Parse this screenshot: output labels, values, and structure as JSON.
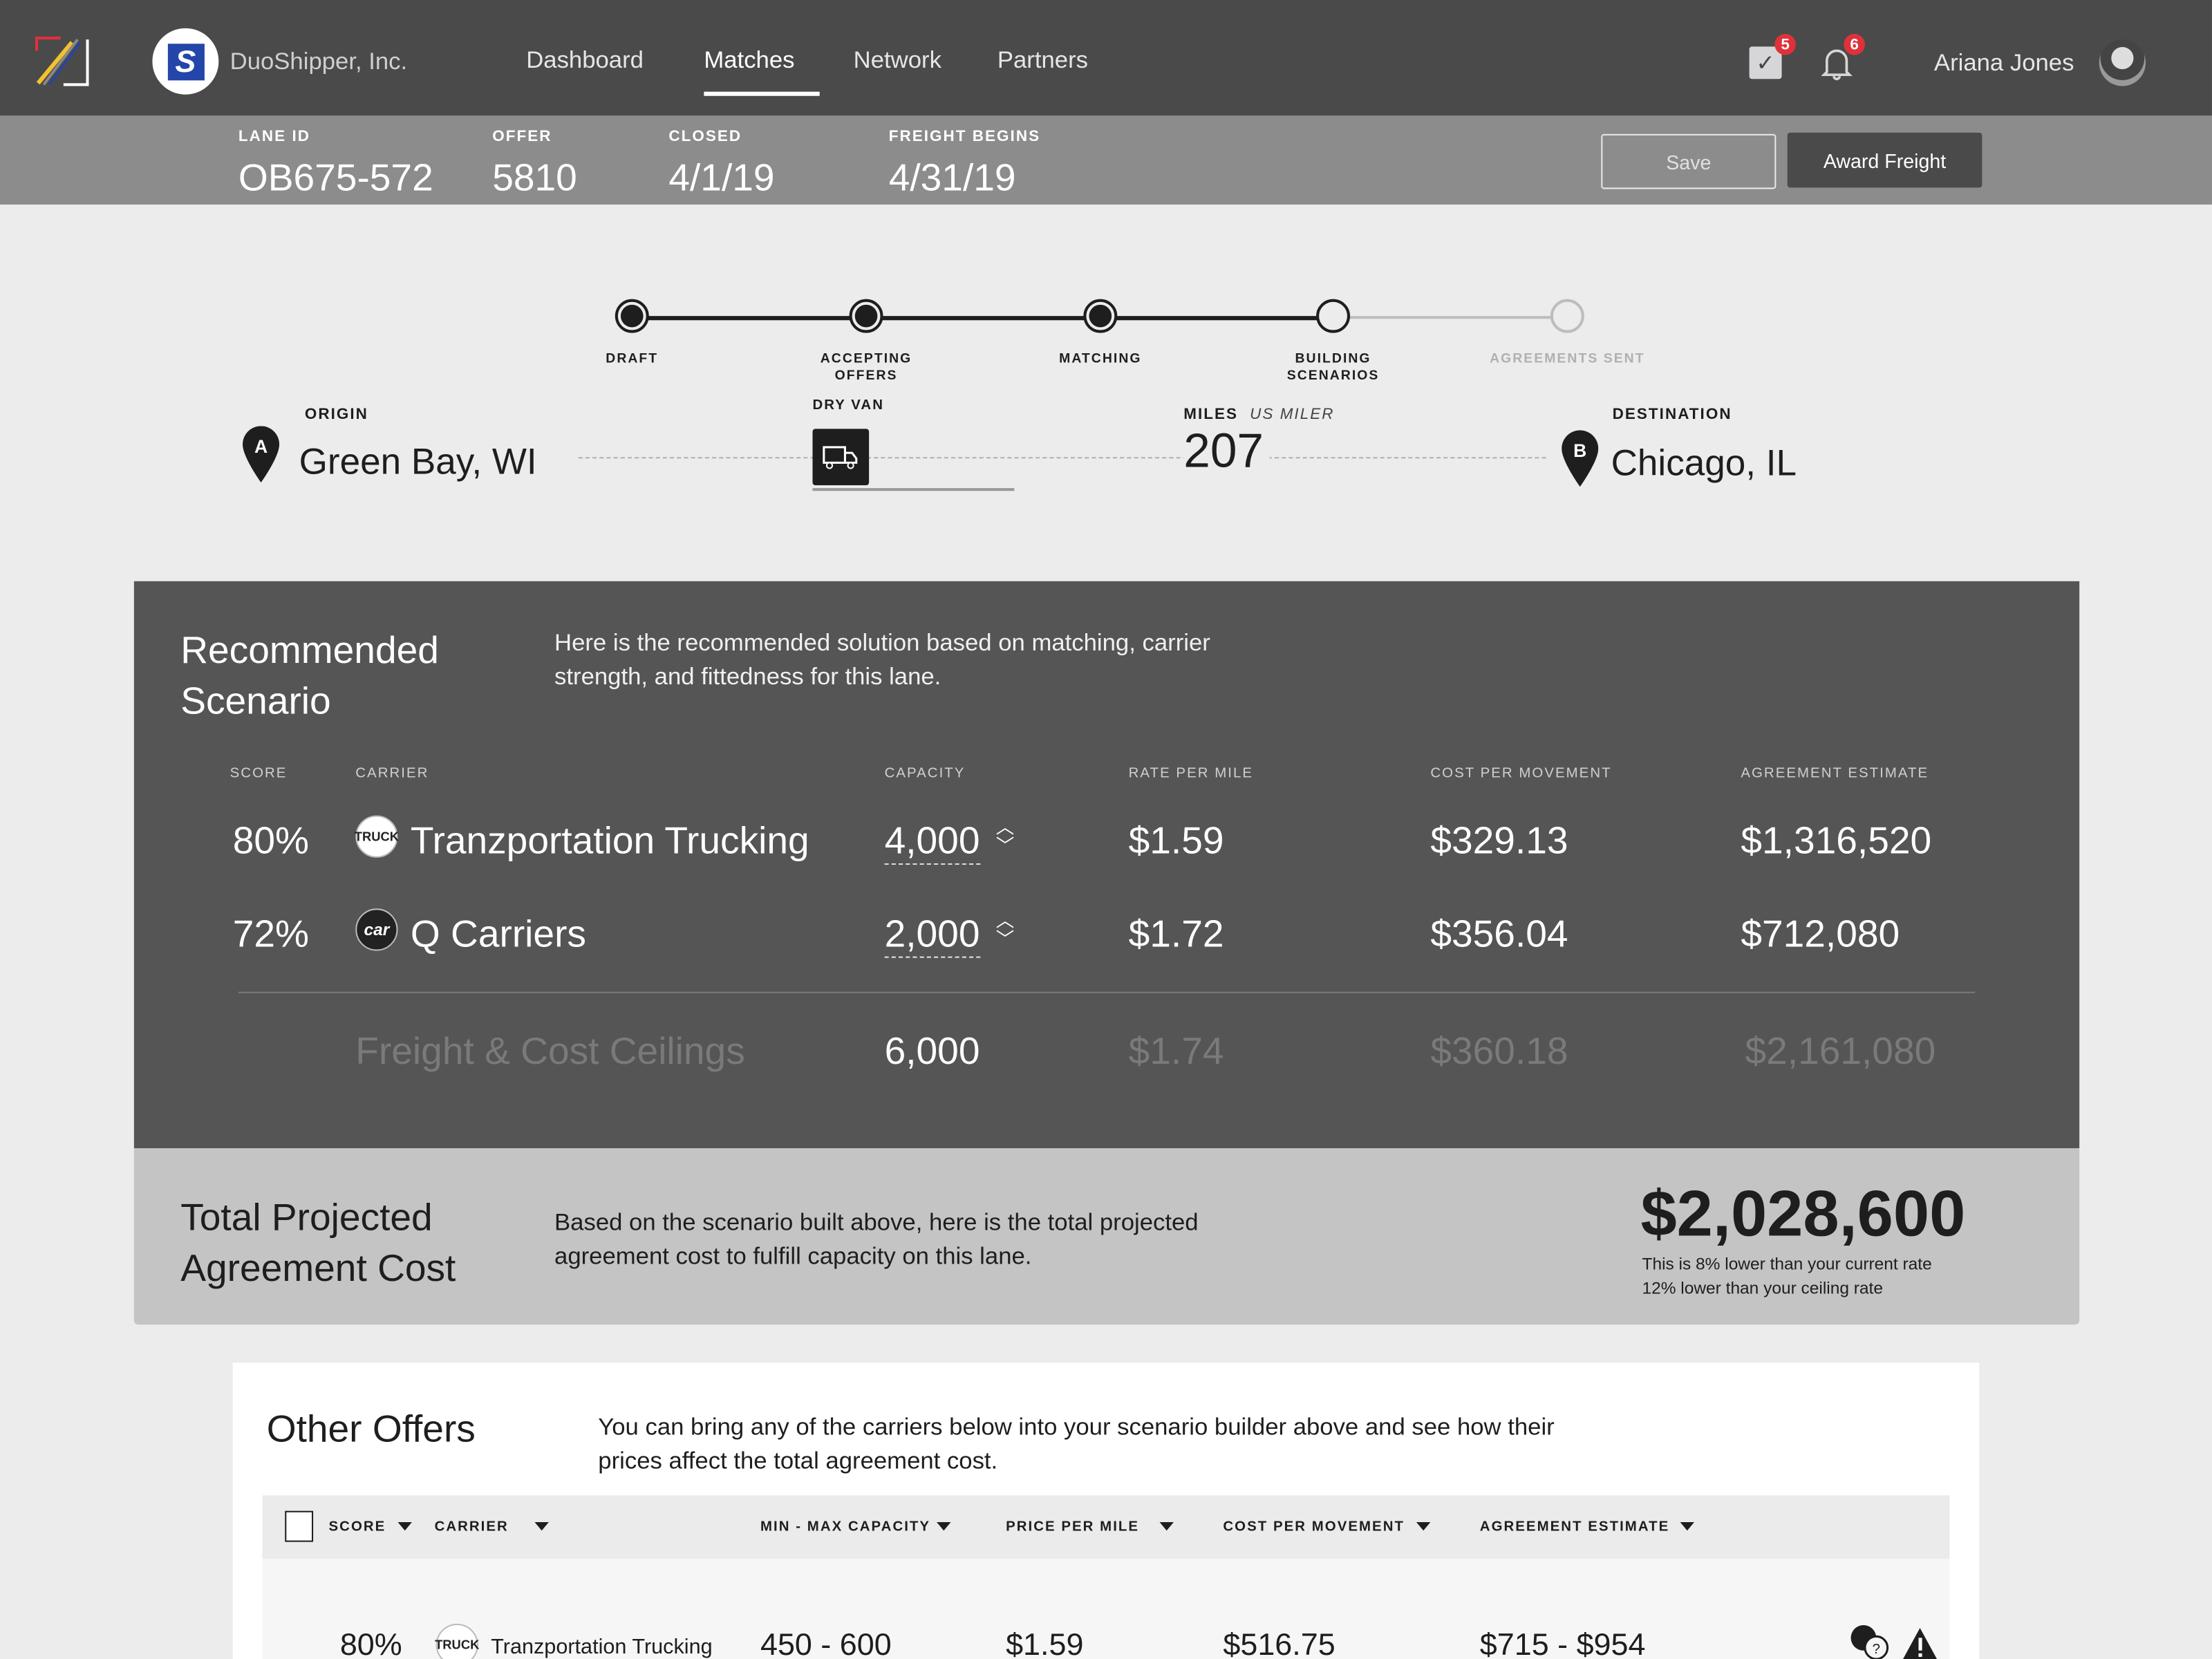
{
  "header": {
    "company": "DuoShipper, Inc.",
    "nav": [
      {
        "label": "Dashboard",
        "active": false
      },
      {
        "label": "Matches",
        "active": true
      },
      {
        "label": "Network",
        "active": false
      },
      {
        "label": "Partners",
        "active": false
      }
    ],
    "tasks_badge": "5",
    "notifications_badge": "6",
    "user_name": "Ariana Jones"
  },
  "lane": {
    "lane_id_label": "LANE ID",
    "lane_id": "OB675-572",
    "offer_label": "OFFER",
    "offer": "5810",
    "closed_label": "CLOSED",
    "closed": "4/1/19",
    "freight_label": "FREIGHT BEGINS",
    "freight_begins": "4/31/19",
    "save": "Save",
    "award": "Award Freight"
  },
  "steps": [
    {
      "label": "DRAFT",
      "state": "done"
    },
    {
      "label": "ACCEPTING OFFERS",
      "state": "done"
    },
    {
      "label": "MATCHING",
      "state": "done"
    },
    {
      "label": "BUILDING SCENARIOS",
      "state": "current"
    },
    {
      "label": "AGREEMENTS SENT",
      "state": "pending"
    }
  ],
  "route": {
    "origin_label": "ORIGIN",
    "origin": "Green Bay, WI",
    "origin_pin": "A",
    "equipment_label": "DRY VAN",
    "miles_label": "MILES",
    "miles_source": "US MILER",
    "miles": "207",
    "destination_label": "DESTINATION",
    "destination": "Chicago, IL",
    "destination_pin": "B"
  },
  "recommended": {
    "title_1": "Recommended",
    "title_2": "Scenario",
    "description": "Here is the recommended solution based on matching, carrier strength, and fittedness for this lane.",
    "columns": [
      "SCORE",
      "CARRIER",
      "CAPACITY",
      "RATE PER MILE",
      "COST PER MOVEMENT",
      "AGREEMENT ESTIMATE"
    ],
    "rows": [
      {
        "score": "80%",
        "carrier": "Tranzportation Trucking",
        "logo": "TRUCK",
        "capacity": "4,000",
        "rate": "$1.59",
        "cost": "$329.13",
        "estimate": "$1,316,520"
      },
      {
        "score": "72%",
        "carrier": "Q Carriers",
        "logo": "car",
        "capacity": "2,000",
        "rate": "$1.72",
        "cost": "$356.04",
        "estimate": "$712,080"
      }
    ],
    "ceiling": {
      "label": "Freight & Cost Ceilings",
      "capacity": "6,000",
      "rate": "$1.74",
      "cost": "$360.18",
      "estimate": "$2,161,080"
    }
  },
  "total": {
    "title_1": "Total Projected",
    "title_2": "Agreement Cost",
    "description": "Based on the scenario built above, here is the total projected agreement cost to fulfill capacity on this lane.",
    "amount": "$2,028,600",
    "note_1": "This is 8% lower than your current rate",
    "note_2": "12% lower than your ceiling rate"
  },
  "other": {
    "title": "Other Offers",
    "description": "You can bring any of the carriers below into your scenario builder above and see how their prices affect the total agreement cost.",
    "columns": [
      "SCORE",
      "CARRIER",
      "MIN - MAX CAPACITY",
      "PRICE PER MILE",
      "COST PER MOVEMENT",
      "AGREEMENT ESTIMATE"
    ],
    "rows": [
      {
        "score": "80%",
        "carrier": "Tranzportation Trucking",
        "logo": "TRUCK",
        "capacity": "450 - 600",
        "rate": "$1.59",
        "cost": "$516.75",
        "estimate": "$715 - $954"
      }
    ]
  },
  "colors": {
    "header": "#4a4a4a",
    "subheader": "#8c8c8c",
    "panel": "#555555",
    "badge": "#e0313a",
    "brand": "#2446a8"
  }
}
